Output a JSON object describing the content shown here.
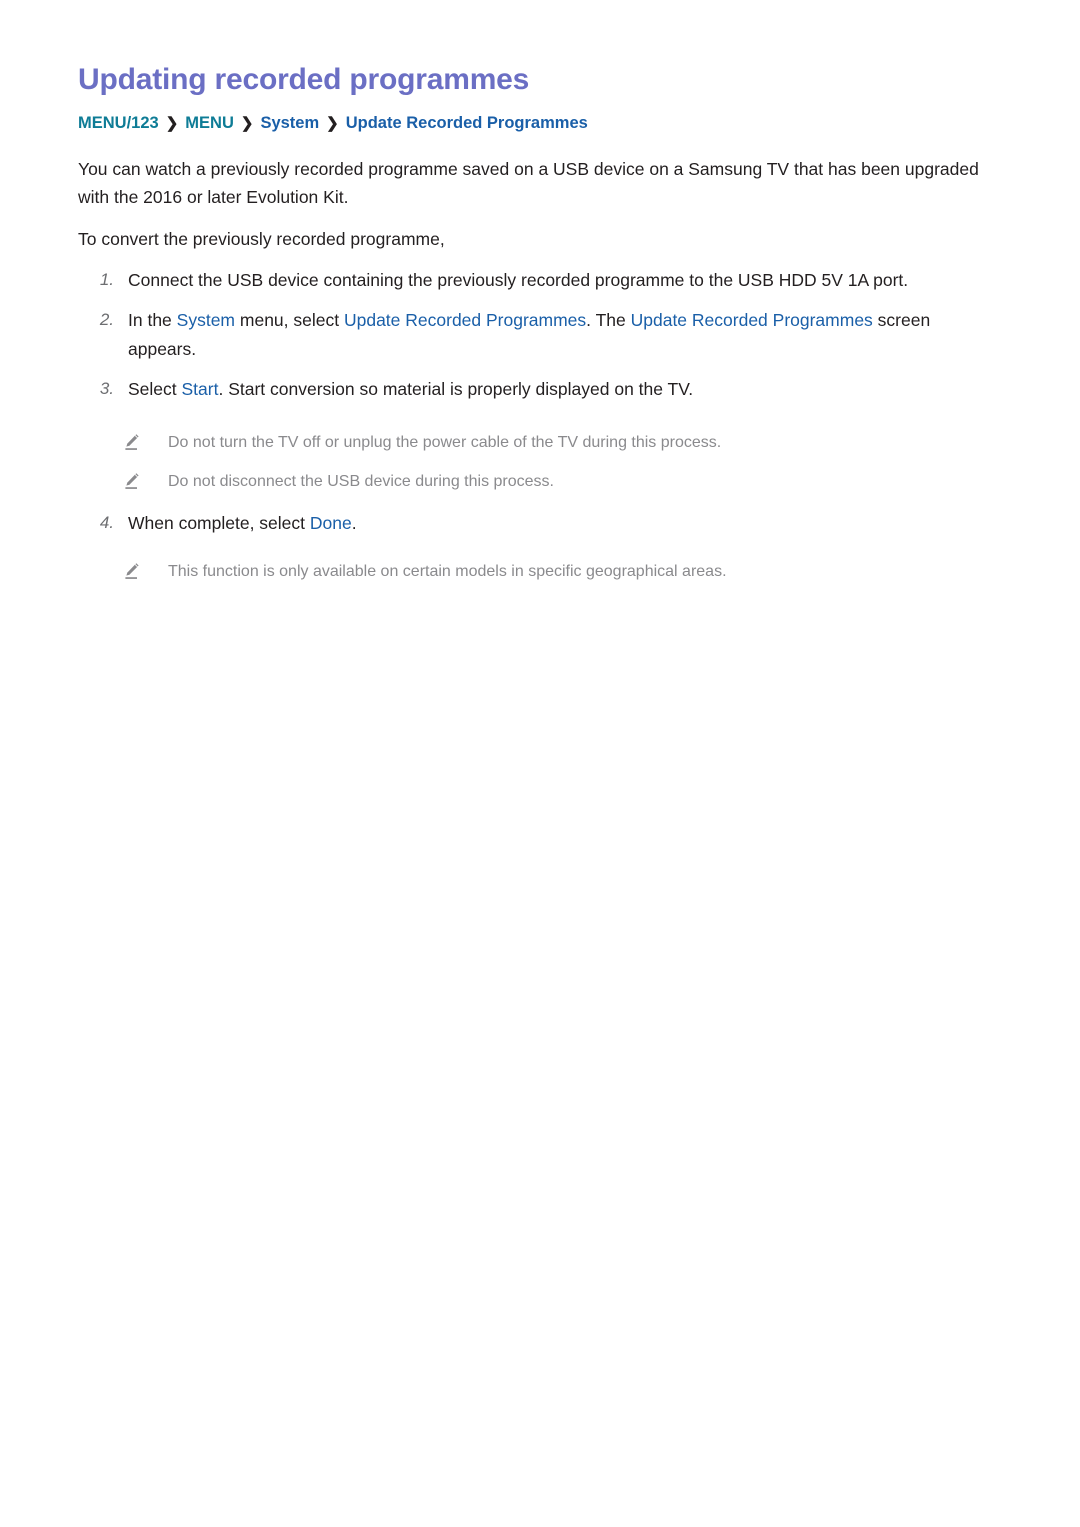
{
  "document": {
    "title": "Updating recorded programmes",
    "breadcrumb": {
      "separator": "❯",
      "items": [
        {
          "label": "MENU/123",
          "style": "teal"
        },
        {
          "label": "MENU",
          "style": "teal"
        },
        {
          "label": "System",
          "style": "blue"
        },
        {
          "label": "Update Recorded Programmes",
          "style": "blue"
        }
      ]
    },
    "intro_paragraphs": [
      "You can watch a previously recorded programme saved on a USB device on a Samsung TV that has been upgraded with the 2016 or later Evolution Kit.",
      "To convert the previously recorded programme,"
    ],
    "steps": [
      {
        "number": "1.",
        "text_parts": [
          {
            "text": "Connect the USB device containing the previously recorded programme to the USB HDD 5V 1A port.",
            "style": "plain"
          }
        ]
      },
      {
        "number": "2.",
        "text_parts": [
          {
            "text": "In the ",
            "style": "plain"
          },
          {
            "text": "System",
            "style": "highlight"
          },
          {
            "text": " menu, select ",
            "style": "plain"
          },
          {
            "text": "Update Recorded Programmes",
            "style": "highlight"
          },
          {
            "text": ". The ",
            "style": "plain"
          },
          {
            "text": "Update Recorded Programmes",
            "style": "highlight"
          },
          {
            "text": " screen appears.",
            "style": "plain"
          }
        ]
      },
      {
        "number": "3.",
        "text_parts": [
          {
            "text": "Select ",
            "style": "plain"
          },
          {
            "text": "Start",
            "style": "highlight"
          },
          {
            "text": ". Start conversion so material is properly displayed on the TV.",
            "style": "plain"
          }
        ]
      },
      {
        "number": "4.",
        "text_parts": [
          {
            "text": "When complete, select ",
            "style": "plain"
          },
          {
            "text": "Done",
            "style": "highlight"
          },
          {
            "text": ".",
            "style": "plain"
          }
        ]
      }
    ],
    "notes_after_step3": [
      {
        "icon": "pencil-icon",
        "text": "Do not turn the TV off or unplug the power cable of the TV during this process."
      },
      {
        "icon": "pencil-icon",
        "text": "Do not disconnect the USB device during this process."
      }
    ],
    "notes_after_step4": [
      {
        "icon": "pencil-icon",
        "text": "This function is only available on certain models in specific geographical areas."
      }
    ]
  },
  "colors": {
    "title": "#6b6fc4",
    "teal": "#0e7c96",
    "blue": "#1a5fa8",
    "body": "#231f20",
    "note": "#8a8a8d",
    "step_number": "#6d6e71",
    "background": "#ffffff"
  }
}
